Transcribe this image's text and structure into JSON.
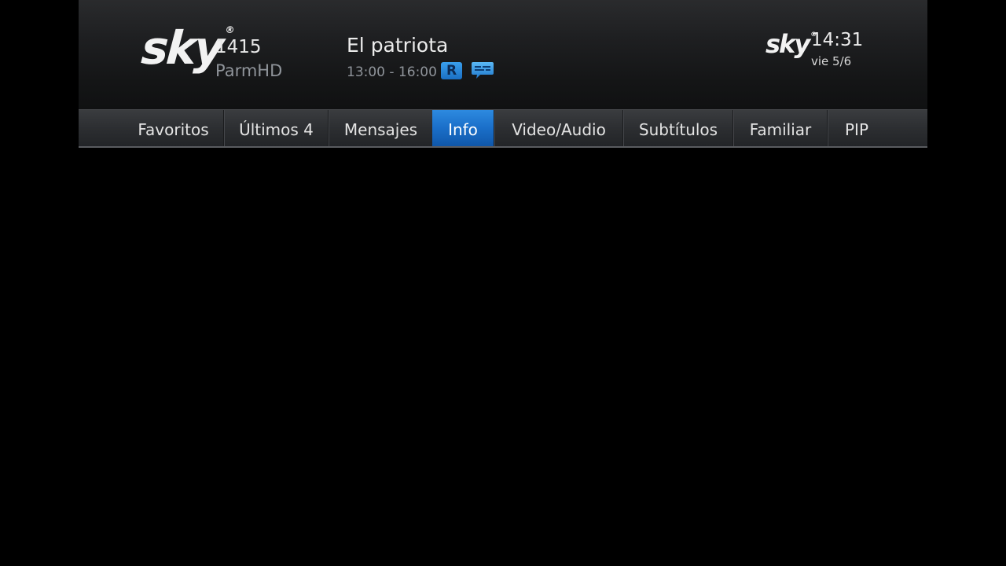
{
  "header": {
    "logo_text": "sky",
    "channel_number": "1415",
    "channel_name": "ParmHD",
    "program_title": "El patriota",
    "program_time": "13:00 - 16:00",
    "rating_badge": "R",
    "subtitles_icon": "subtitles-speech-bubble-icon",
    "small_logo_text": "sky",
    "clock_time": "14:31",
    "clock_date": "vie 5/6"
  },
  "tabs": [
    {
      "label": "Favoritos"
    },
    {
      "label": "Últimos 4"
    },
    {
      "label": "Mensajes"
    },
    {
      "label": "Info",
      "active": true
    },
    {
      "label": "Video/Audio"
    },
    {
      "label": "Subtítulos"
    },
    {
      "label": "Familiar"
    },
    {
      "label": "PIP"
    }
  ],
  "colors": {
    "accent_blue": "#1a6ec8",
    "background": "#000000",
    "muted_text": "#8f949a"
  }
}
